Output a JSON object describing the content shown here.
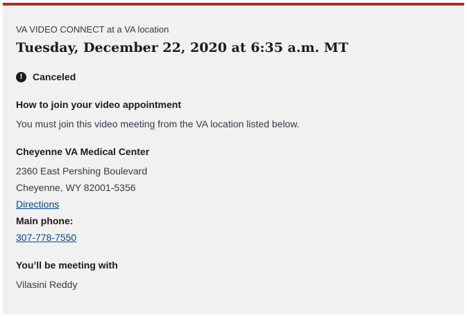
{
  "appointment": {
    "type_line": "VA VIDEO CONNECT at a VA location",
    "date_heading": "Tuesday, December 22, 2020 at 6:35 a.m. MT",
    "status": {
      "icon": "exclamation-circle-icon",
      "label": "Canceled"
    },
    "join": {
      "heading": "How to join your video appointment",
      "text": "You must join this video meeting from the VA location listed below."
    },
    "location": {
      "name": "Cheyenne VA Medical Center",
      "address_line1": "2360 East Pershing Boulevard",
      "address_line2": "Cheyenne, WY 82001-5356",
      "directions_link": "Directions",
      "phone_label": "Main phone:",
      "phone": "307-778-7550"
    },
    "meeting_with": {
      "heading": "You’ll be meeting with",
      "name": "Vilasini Reddy"
    }
  },
  "colors": {
    "accent_top_border": "#b5272d",
    "card_background": "#f1f1f1",
    "link": "#004795"
  }
}
